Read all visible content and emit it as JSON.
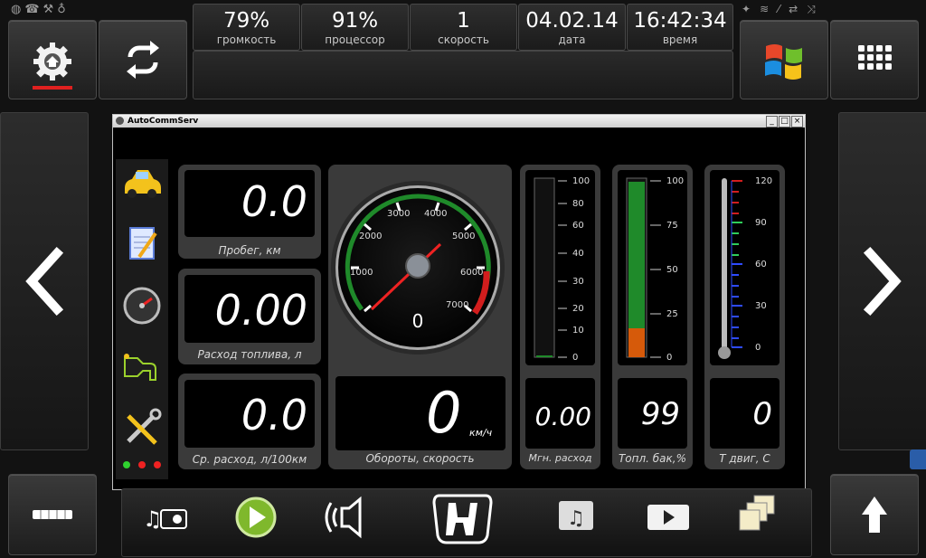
{
  "status": {
    "volume": {
      "value": "79%",
      "label": "громкость"
    },
    "cpu": {
      "value": "91%",
      "label": "процессор"
    },
    "speed": {
      "value": "1",
      "label": "скорость"
    },
    "date": {
      "value": "04.02.14",
      "label": "дата"
    },
    "time": {
      "value": "16:42:34",
      "label": "время"
    }
  },
  "window": {
    "title": "AutoCommServ"
  },
  "gauges": {
    "mileage": {
      "value": "0.0",
      "label": "Пробег, км"
    },
    "fuel_used": {
      "value": "0.00",
      "label": "Расход топлива, л"
    },
    "avg_consumption": {
      "value": "0.0",
      "label": "Ср. расход, л/100км"
    },
    "rpm_speed_label": "Обороты, скорость",
    "speed_value": "0",
    "speed_unit": "км/ч",
    "tacho_value": "0",
    "tacho_ticks": [
      "1000",
      "2000",
      "3000",
      "4000",
      "5000",
      "6000",
      "7000"
    ],
    "instant": {
      "value": "0.00",
      "label": "Мгн. расход",
      "scale": [
        "100",
        "80",
        "60",
        "40",
        "30",
        "20",
        "10",
        "0"
      ],
      "level": 0.0
    },
    "fuel_tank": {
      "value": "99",
      "label": "Топл. бак,%",
      "scale": [
        "100",
        "75",
        "50",
        "25",
        "0"
      ],
      "level": 0.99
    },
    "engine_temp": {
      "value": "0",
      "label": "Т двиг, С",
      "scale": [
        "120",
        "90",
        "60",
        "30",
        "0"
      ],
      "level": 0.0
    }
  },
  "colors": {
    "accent_green": "#1f8a2a",
    "accent_red": "#d21d1d",
    "fuel_orange": "#d65a0a"
  }
}
